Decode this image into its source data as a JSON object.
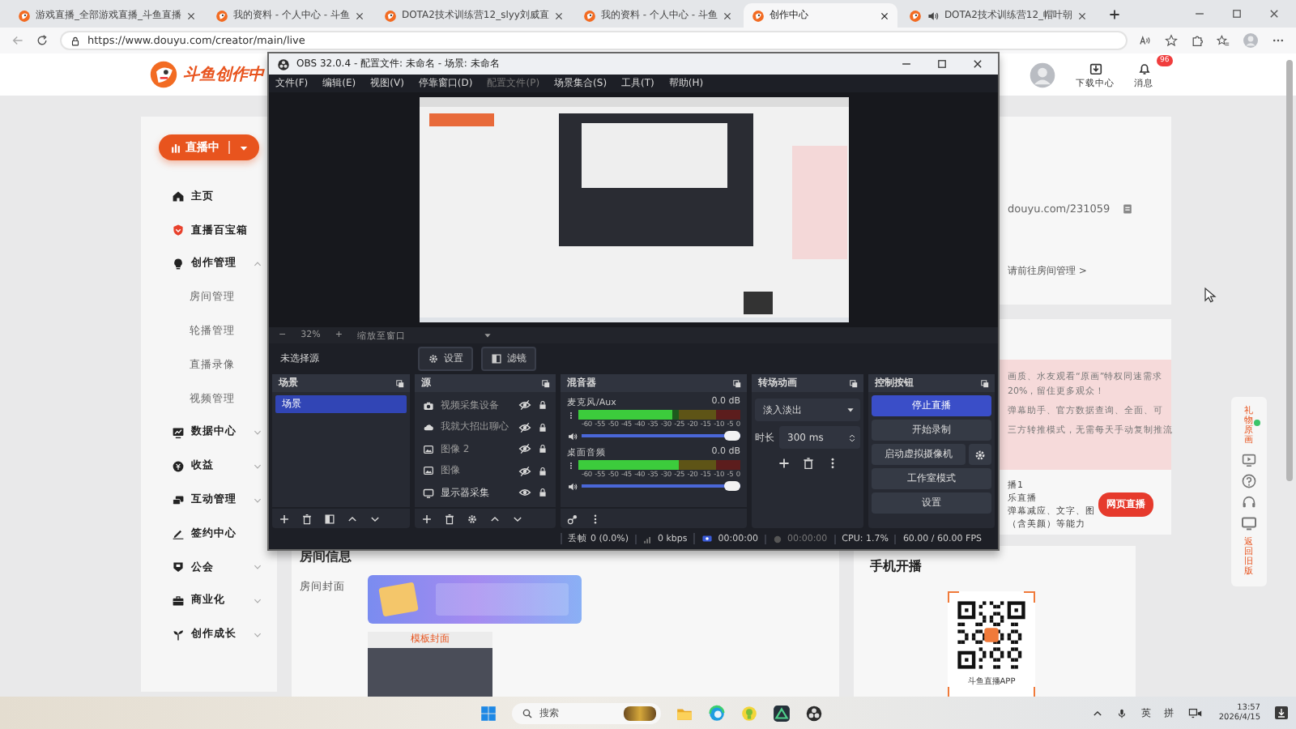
{
  "browser": {
    "tabs": [
      {
        "title": "游戏直播_全部游戏直播_斗鱼直播",
        "selected": false,
        "audio": false
      },
      {
        "title": "我的资料 - 个人中心 - 斗鱼",
        "selected": false,
        "audio": false
      },
      {
        "title": "DOTA2技术训练营12_slyy刘威直",
        "selected": false,
        "audio": false
      },
      {
        "title": "我的资料 - 个人中心 - 斗鱼",
        "selected": false,
        "audio": false
      },
      {
        "title": "创作中心",
        "selected": true,
        "audio": false
      },
      {
        "title": "DOTA2技术训练营12_帽叶朝",
        "selected": false,
        "audio": true
      }
    ],
    "url": "https://www.douyu.com/creator/main/live"
  },
  "page": {
    "header": {
      "logo": "斗鱼创作中",
      "download": "下载中心",
      "messages": "消息",
      "message_badge": "96"
    },
    "sidebar": {
      "live_button": "直播中",
      "items": [
        {
          "label": "主页"
        },
        {
          "label": "直播百宝箱"
        },
        {
          "label": "创作管理",
          "expanded": true,
          "children": [
            {
              "label": "房间管理"
            },
            {
              "label": "轮播管理"
            },
            {
              "label": "直播录像"
            },
            {
              "label": "视频管理"
            }
          ]
        },
        {
          "label": "数据中心",
          "expanded": false
        },
        {
          "label": "收益",
          "expanded": false
        },
        {
          "label": "互动管理",
          "expanded": false
        },
        {
          "label": "签约中心"
        },
        {
          "label": "公会",
          "expanded": false
        },
        {
          "label": "商业化",
          "expanded": false
        },
        {
          "label": "创作成长",
          "expanded": false
        }
      ]
    },
    "room": {
      "title": "房间信息",
      "cover_label": "房间封面",
      "template_label": "模板封面"
    },
    "address": {
      "link": "douyu.com/231059",
      "manage_link": "请前往房间管理 >"
    },
    "notice": {
      "paragraphs": [
        [
          "画质、水友观看“原画”特权同速需求",
          "20%，留住更多观众！"
        ],
        [
          "弹幕助手、官方数据查询、全面、可"
        ],
        [
          "三方转推模式，无需每天手动复制推流"
        ]
      ]
    },
    "promo": {
      "lines": [
        "播1",
        "乐直播",
        "弹幕减应、文字、图",
        "（含美颜）等能力"
      ],
      "button": "网页直播"
    },
    "mobile": {
      "title": "手机开播",
      "qr_caption": "斗鱼直播APP"
    },
    "float_bar": {
      "top_label": "礼物原画",
      "bottom_label": "返回旧版"
    }
  },
  "obs": {
    "title": "OBS 32.0.4 - 配置文件: 未命名 - 场景: 未命名",
    "menu": [
      {
        "label": "文件(F)",
        "disabled": false
      },
      {
        "label": "编辑(E)",
        "disabled": false
      },
      {
        "label": "视图(V)",
        "disabled": false
      },
      {
        "label": "停靠窗口(D)",
        "disabled": false
      },
      {
        "label": "配置文件(P)",
        "disabled": true
      },
      {
        "label": "场景集合(S)",
        "disabled": false
      },
      {
        "label": "工具(T)",
        "disabled": false
      },
      {
        "label": "帮助(H)",
        "disabled": false
      }
    ],
    "zoom": {
      "minus": "−",
      "percent": "32%",
      "plus": "+",
      "fit": "缩放至窗口"
    },
    "source_toolbar": {
      "status": "未选择源",
      "buttons": [
        "设置",
        "滤镜"
      ]
    },
    "scenes": {
      "title": "场景",
      "items": [
        {
          "name": "场景",
          "selected": true
        }
      ]
    },
    "sources": {
      "title": "源",
      "items": [
        {
          "name": "视频采集设备",
          "kind": "camera",
          "visible": false
        },
        {
          "name": "我就大招出聊心",
          "kind": "cloud",
          "visible": false
        },
        {
          "name": "图像 2",
          "kind": "image",
          "visible": false
        },
        {
          "name": "图像",
          "kind": "image",
          "visible": false
        },
        {
          "name": "显示器采集",
          "kind": "display",
          "visible": true
        }
      ]
    },
    "mixer": {
      "title": "混音器",
      "channels": [
        {
          "name": "麦克风/Aux",
          "reading": "0.0 dB",
          "meter": {
            "level": 0.58
          },
          "ticks": [
            "-60",
            "-55",
            "-50",
            "-45",
            "-40",
            "-35",
            "-30",
            "-25",
            "-20",
            "-15",
            "-10",
            "-5",
            "0"
          ],
          "volume": {
            "level": 1
          }
        },
        {
          "name": "桌面音频",
          "reading": "0.0 dB",
          "meter": {
            "level": 0.62
          },
          "ticks": [
            "-60",
            "-55",
            "-50",
            "-45",
            "-40",
            "-35",
            "-30",
            "-25",
            "-20",
            "-15",
            "-10",
            "-5",
            "0"
          ],
          "volume": {
            "level": 1
          }
        }
      ]
    },
    "transition": {
      "title": "转场动画",
      "type": "淡入淡出",
      "duration_label": "时长",
      "duration": "300 ms"
    },
    "controls": {
      "title": "控制按钮",
      "buttons": [
        {
          "label": "停止直播",
          "active": true,
          "kind": "plain"
        },
        {
          "label": "开始录制",
          "active": false,
          "kind": "plain"
        },
        {
          "label": "启动虚拟摄像机",
          "active": false,
          "kind": "with_settings"
        },
        {
          "label": "工作室模式",
          "active": false,
          "kind": "plain"
        },
        {
          "label": "设置",
          "active": false,
          "kind": "plain"
        }
      ]
    },
    "status": {
      "dropped": "丢帧 0 (0.0%)",
      "bitrate": "0 kbps",
      "stream_time": "00:00:00",
      "record_time": "00:00:00",
      "cpu": "CPU: 1.7%",
      "fps": "60.00 / 60.00 FPS"
    }
  },
  "taskbar": {
    "search": "搜索",
    "ime_lang": "英",
    "ime_mode": "拼",
    "time": "13:57",
    "date": "2026/4/15"
  }
}
